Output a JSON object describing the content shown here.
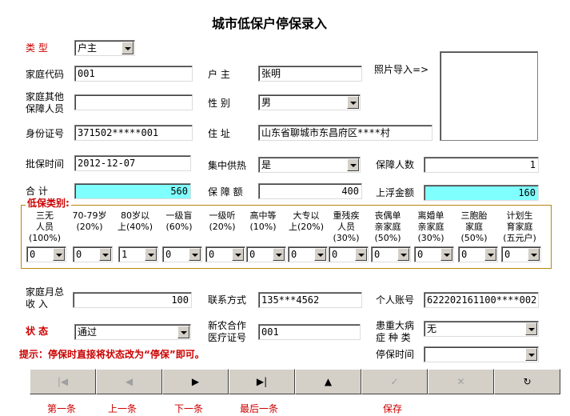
{
  "title": "城市低保户停保录入",
  "type": {
    "label": "类    型",
    "value": "户主"
  },
  "family_code": {
    "label": "家庭代码",
    "value": "001"
  },
  "householder": {
    "label": "户    主",
    "value": "张明"
  },
  "photo": {
    "label": "照片导入=>"
  },
  "other_members": {
    "label_line1": "家庭其他",
    "label_line2": "保障人员",
    "value": ""
  },
  "gender": {
    "label": "性    别",
    "value": "男"
  },
  "id_number": {
    "label": "身份证号",
    "value": "371502*****001"
  },
  "address": {
    "label": "住    址",
    "value": "山东省聊城市东昌府区****村"
  },
  "approval_time": {
    "label": "批保时间",
    "value": "2012-12-07"
  },
  "central_heating": {
    "label": "集中供热",
    "value": "是"
  },
  "covered_count": {
    "label": "保障人数",
    "value": "1"
  },
  "total": {
    "label": "合    计",
    "value": "560"
  },
  "guarantee_amount": {
    "label": "保 障 额",
    "value": "400"
  },
  "float_amount": {
    "label": "上浮金额",
    "value": "160"
  },
  "category_group": {
    "title": "低保类别:",
    "columns": [
      {
        "l1": "三无",
        "l2": "人员",
        "l3": "(100%)",
        "value": "0"
      },
      {
        "l1": "70-79岁",
        "l2": "(20%)",
        "l3": "",
        "value": "0"
      },
      {
        "l1": "80岁以",
        "l2": "上(40%)",
        "l3": "",
        "value": "1"
      },
      {
        "l1": "一级盲",
        "l2": "(60%)",
        "l3": "",
        "value": "0"
      },
      {
        "l1": "一级听",
        "l2": "(20%)",
        "l3": "",
        "value": "0"
      },
      {
        "l1": "高中等",
        "l2": "(10%)",
        "l3": "",
        "value": "0"
      },
      {
        "l1": "大专以",
        "l2": "上(20%)",
        "l3": "",
        "value": "0"
      },
      {
        "l1": "重残疾",
        "l2": "人员",
        "l3": "(30%)",
        "value": "0"
      },
      {
        "l1": "丧偶单",
        "l2": "亲家庭",
        "l3": "(50%)",
        "value": "0"
      },
      {
        "l1": "离婚单",
        "l2": "亲家庭",
        "l3": "(30%)",
        "value": "0"
      },
      {
        "l1": "三胞胎",
        "l2": "家庭",
        "l3": "(50%)",
        "value": "0"
      },
      {
        "l1": "计划生",
        "l2": "育家庭",
        "l3": "(五元户)",
        "value": "0"
      }
    ]
  },
  "monthly_income": {
    "label_line1": "家庭月总",
    "label_line2": "收    入",
    "value": "100"
  },
  "contact": {
    "label": "联系方式",
    "value": "135***4562"
  },
  "account": {
    "label": "个人账号",
    "value": "622202161100****002"
  },
  "status": {
    "label": "状    态",
    "value": "通过"
  },
  "medical_cert": {
    "label_line1": "新农合作",
    "label_line2": "医疗证号",
    "value": "001"
  },
  "illness": {
    "label_line1": "患重大病",
    "label_line2": "症 种 类",
    "value": "无"
  },
  "hint": "提示：停保时直接将状态改为“停保”即可。",
  "stop_time": {
    "label": "停保时间",
    "value": ""
  },
  "nav": {
    "first_icon": "|◀",
    "prev_icon": "◀",
    "next_icon": "▶",
    "last_icon": "▶|",
    "up_icon": "▲",
    "save_icon": "✓",
    "cancel_icon": "✕",
    "refresh_icon": "↻",
    "first_label": "第一条",
    "prev_label": "上一条",
    "next_label": "下一条",
    "last_label": "最后一条",
    "save_label": "保存"
  }
}
